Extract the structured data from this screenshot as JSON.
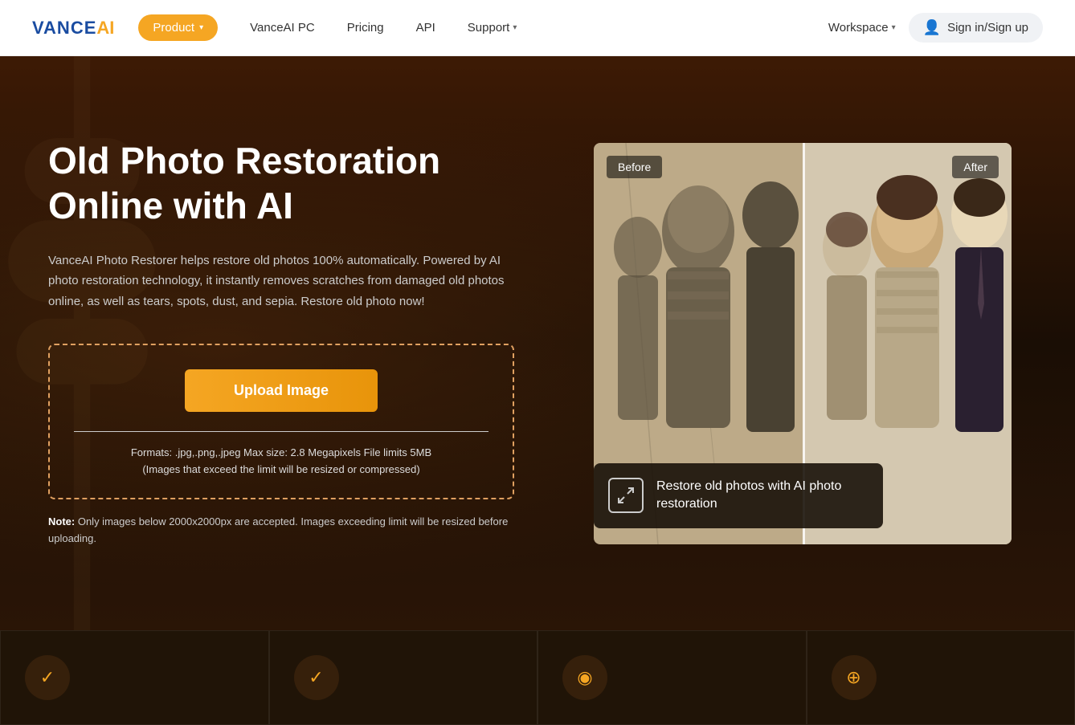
{
  "nav": {
    "logo_vance": "VANCE",
    "logo_ai": "AI",
    "product_label": "Product",
    "product_chevron": "▾",
    "links": [
      {
        "id": "vanceai-pc",
        "label": "VanceAI PC"
      },
      {
        "id": "pricing",
        "label": "Pricing"
      },
      {
        "id": "api",
        "label": "API"
      },
      {
        "id": "support",
        "label": "Support",
        "has_chevron": true
      }
    ],
    "workspace_label": "Workspace",
    "workspace_chevron": "▾",
    "signin_label": "Sign in/Sign up"
  },
  "hero": {
    "title_line1": "Old Photo Restoration",
    "title_line2": "Online with AI",
    "description": "VanceAI Photo Restorer helps restore old photos 100% automatically. Powered by AI photo restoration technology, it instantly removes scratches from damaged old photos online, as well as tears, spots, dust, and sepia. Restore old photo now!",
    "upload_button_label": "Upload Image",
    "formats_text": "Formats: .jpg,.png,.jpeg Max size: 2.8 Megapixels File limits 5MB",
    "resize_text": "(Images that exceed the limit will be resized or compressed)",
    "note_label": "Note:",
    "note_text": "Only images below 2000x2000px are accepted. Images exceeding limit will be resized before uploading.",
    "label_before": "Before",
    "label_after": "After",
    "info_text_line1": "Restore old photos with AI photo",
    "info_text_line2": "restoration"
  },
  "cards": [
    {
      "id": "card1",
      "icon": "✓"
    },
    {
      "id": "card2",
      "icon": "✓"
    },
    {
      "id": "card3",
      "icon": "◉"
    },
    {
      "id": "card4",
      "icon": "⊕"
    }
  ],
  "colors": {
    "accent_orange": "#f5a623",
    "text_light": "#ffffff",
    "text_muted": "#cccccc",
    "bg_dark": "#1a0e05"
  }
}
